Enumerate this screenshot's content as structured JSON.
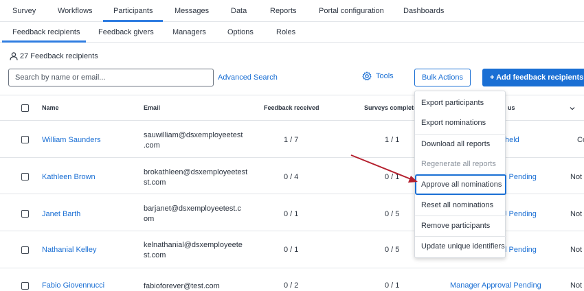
{
  "top_tabs": [
    "Survey",
    "Workflows",
    "Participants",
    "Messages",
    "Data",
    "Reports",
    "Portal configuration",
    "Dashboards"
  ],
  "sub_tabs": [
    "Feedback recipients",
    "Feedback givers",
    "Managers",
    "Options",
    "Roles"
  ],
  "recipient_count": "27 Feedback recipients",
  "search": {
    "placeholder": "Search by name or email..."
  },
  "advanced_search": "Advanced Search",
  "tools_label": "Tools",
  "bulk_actions_label": "Bulk Actions",
  "add_button_label": "+  Add feedback recipients",
  "columns": {
    "name": "Name",
    "email": "Email",
    "feedback_received": "Feedback received",
    "surveys_completed": "Surveys complete",
    "status_partial": "us"
  },
  "rows": [
    {
      "name": "William Saunders",
      "email_1": "sauwilliam@dsxemployeetest",
      "email_2": ".com",
      "feedback": "1 / 7",
      "surveys": "1 / 1",
      "status": "held",
      "last": "Co"
    },
    {
      "name": "Kathleen Brown",
      "email_1": "brokathleen@dsxemployeetest",
      "email_2": "st.com",
      "feedback": "0 / 4",
      "surveys": "0 / 1",
      "status": "l Pending",
      "last": "Not c"
    },
    {
      "name": "Janet Barth",
      "email_1": "barjanet@dsxemployeetest.c",
      "email_2": "om",
      "feedback": "0 / 1",
      "surveys": "0 / 5",
      "status": "l Pending",
      "last": "Not c"
    },
    {
      "name": "Nathanial Kelley",
      "email_1": "kelnathanial@dsxemployeete",
      "email_2": "st.com",
      "feedback": "0 / 1",
      "surveys": "0 / 5",
      "status": "l Pending",
      "last": "Not c"
    },
    {
      "name": "Fabio Giovennucci",
      "email_1": "fabioforever@test.com",
      "email_2": "",
      "feedback": "0 / 2",
      "surveys": "0 / 1",
      "status": "Manager Approval Pending",
      "last": "Not c"
    }
  ],
  "bulk_menu": [
    "Export participants",
    "Export nominations",
    "Download all reports",
    "Regenerate all reports",
    "Approve all nominations",
    "Reset all nominations",
    "Remove participants",
    "Update unique identifiers"
  ],
  "colors": {
    "accent": "#1a6fd4",
    "annotation_arrow": "#b5202e"
  }
}
